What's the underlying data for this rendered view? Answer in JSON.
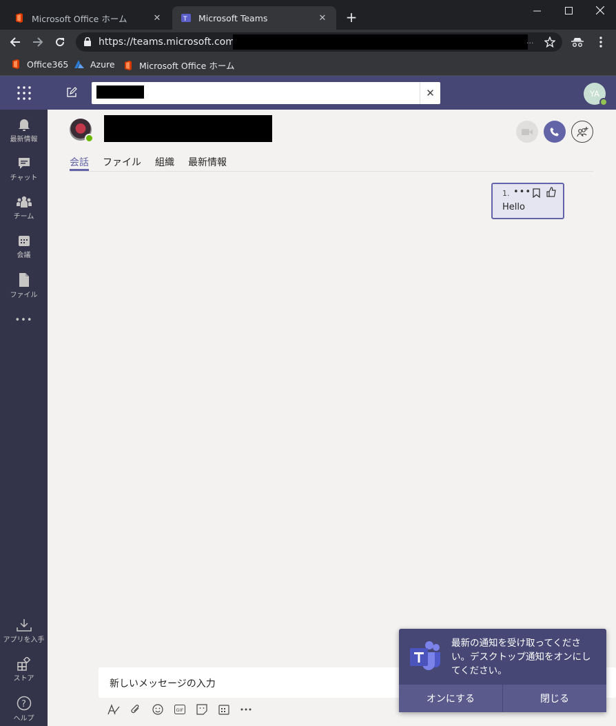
{
  "browser": {
    "tabs": [
      {
        "title": "Microsoft Office ホーム",
        "close": "✕"
      },
      {
        "title": "Microsoft Teams",
        "close": "✕"
      }
    ],
    "new_tab": "+",
    "url": "https://teams.microsoft.com/_#",
    "url_trailing": "...",
    "bookmarks": [
      "Office365",
      "Azure",
      "Microsoft Office ホーム"
    ]
  },
  "header": {
    "avatar_initials": "YA",
    "search_clear": "✕"
  },
  "rail": {
    "items": [
      {
        "label": "最新情報",
        "icon": "bell-icon"
      },
      {
        "label": "チャット",
        "icon": "chat-icon"
      },
      {
        "label": "チーム",
        "icon": "teams-icon"
      },
      {
        "label": "会議",
        "icon": "calendar-icon"
      },
      {
        "label": "ファイル",
        "icon": "file-icon"
      }
    ],
    "more": "•••",
    "bottom": [
      {
        "label": "アプリを入手",
        "icon": "download-icon"
      },
      {
        "label": "ストア",
        "icon": "store-icon"
      },
      {
        "label": "ヘルプ",
        "icon": "help-icon"
      }
    ]
  },
  "conversation": {
    "tabs": [
      "会話",
      "ファイル",
      "組織",
      "最新情報"
    ],
    "active_tab": "会話"
  },
  "message": {
    "time": "1.",
    "more": "•••",
    "text": "Hello"
  },
  "composer": {
    "placeholder": "新しいメッセージの入力"
  },
  "toast": {
    "message": "最新の通知を受け取ってください。デスクトップ通知をオンにしてください。",
    "enable_label": "オンにする",
    "close_label": "閉じる"
  },
  "colors": {
    "teams_purple": "#464775",
    "accent": "#6264a7",
    "rail": "#33344a"
  }
}
